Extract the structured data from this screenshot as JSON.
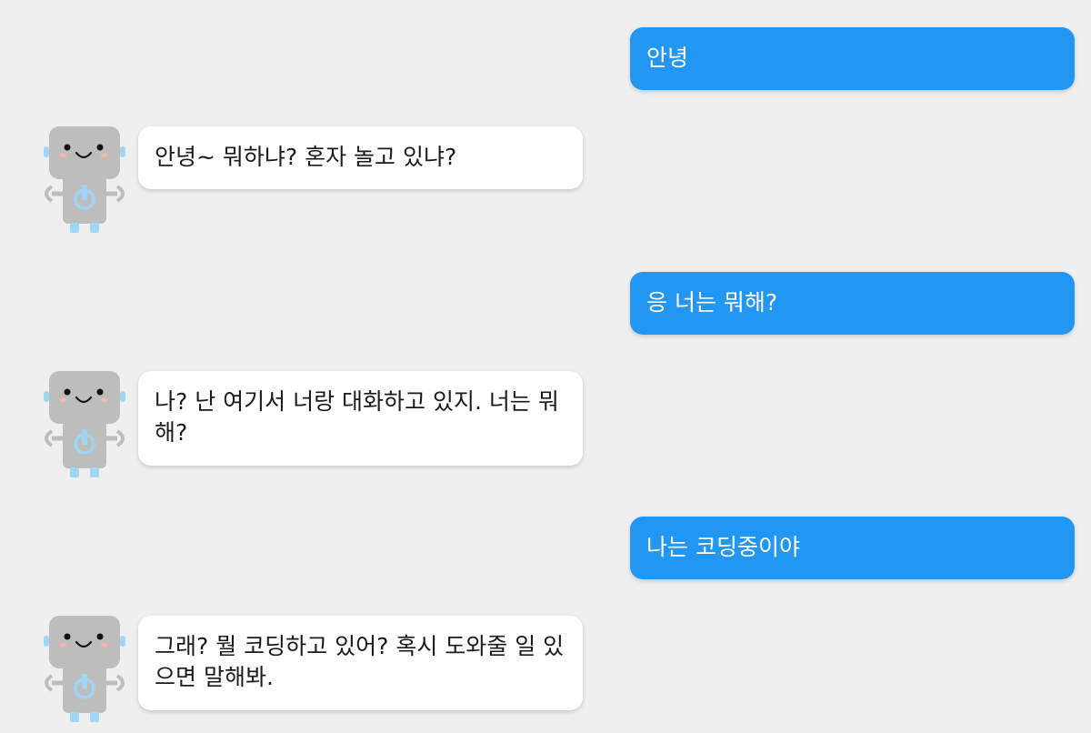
{
  "colors": {
    "background": "#efefef",
    "user_bubble": "#2196f3",
    "user_text": "#ffffff",
    "bot_bubble": "#ffffff",
    "bot_text": "#1a1a1a",
    "robot_body": "#bdbdbd",
    "robot_accent": "#9fd6f5"
  },
  "messages": [
    {
      "sender": "user",
      "text": "안녕"
    },
    {
      "sender": "bot",
      "avatar_icon": "robot-icon",
      "text": "안녕~ 뭐하냐? 혼자 놀고 있냐?"
    },
    {
      "sender": "user",
      "text": "응 너는 뭐해?"
    },
    {
      "sender": "bot",
      "avatar_icon": "robot-icon",
      "text": "나? 난 여기서 너랑 대화하고 있지. 너는 뭐해?"
    },
    {
      "sender": "user",
      "text": "나는 코딩중이야"
    },
    {
      "sender": "bot",
      "avatar_icon": "robot-icon",
      "text": "그래? 뭘 코딩하고 있어? 혹시 도와줄 일 있으면 말해봐."
    }
  ]
}
